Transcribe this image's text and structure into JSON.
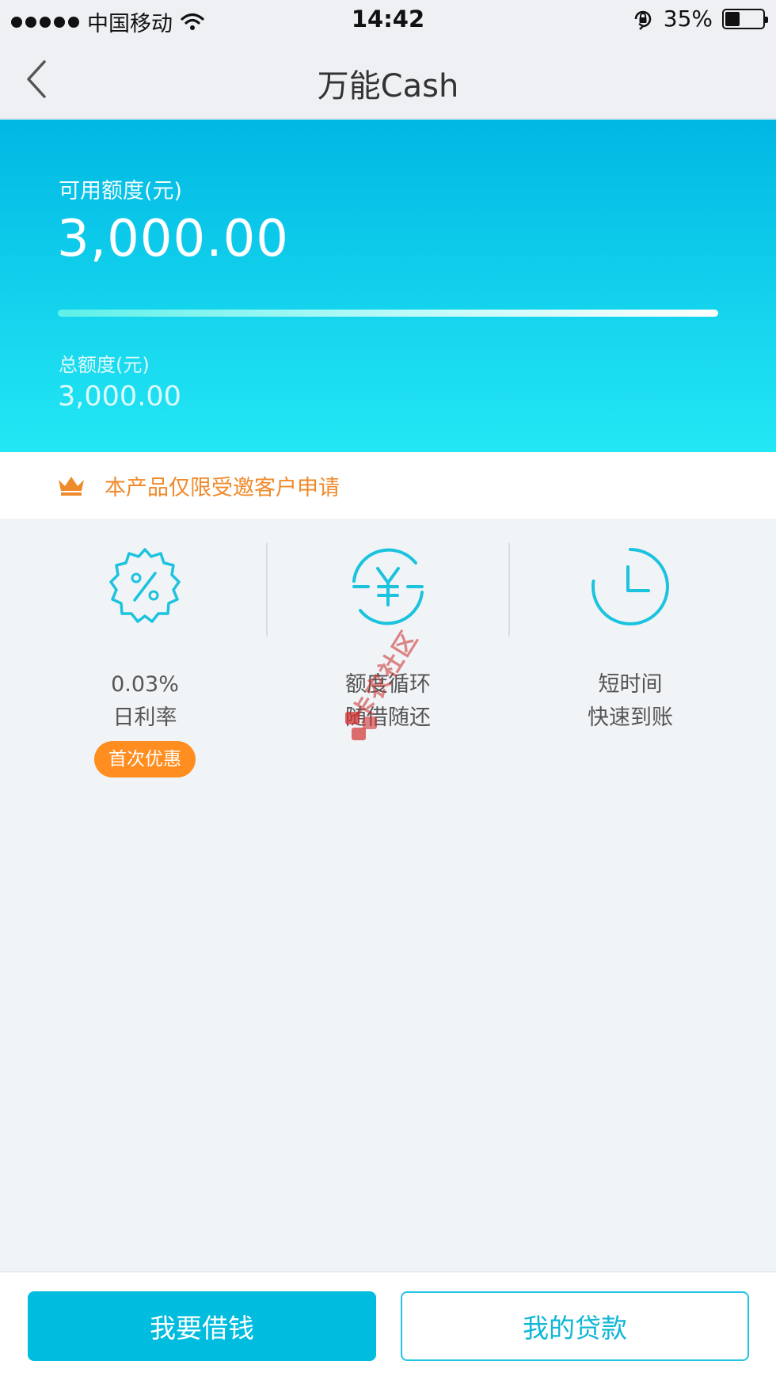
{
  "status_bar": {
    "carrier": "中国移动",
    "time": "14:42",
    "battery_text": "35%",
    "battery_level": 0.35
  },
  "nav": {
    "title": "万能Cash",
    "back_icon": "chevron-left-icon"
  },
  "credit": {
    "available_label": "可用额度(元)",
    "available_amount": "3,000.00",
    "total_label": "总额度(元)",
    "total_amount": "3,000.00",
    "available_ratio": 1.0
  },
  "notice": {
    "icon": "crown-icon",
    "text": "本产品仅限受邀客户申请"
  },
  "features": [
    {
      "icon": "percent-badge-icon",
      "line1": "0.03%",
      "line2": "日利率",
      "badge": "首次优惠"
    },
    {
      "icon": "yuan-cycle-icon",
      "line1": "额度循环",
      "line2": "随借随还"
    },
    {
      "icon": "clock-icon",
      "line1": "短时间",
      "line2": "快速到账"
    }
  ],
  "watermark": {
    "text": "卡农社区"
  },
  "actions": {
    "borrow_label": "我要借钱",
    "my_loans_label": "我的贷款"
  },
  "colors": {
    "accent": "#00bde0",
    "notice": "#ef8a2b",
    "badge": "#ff8d1f"
  }
}
